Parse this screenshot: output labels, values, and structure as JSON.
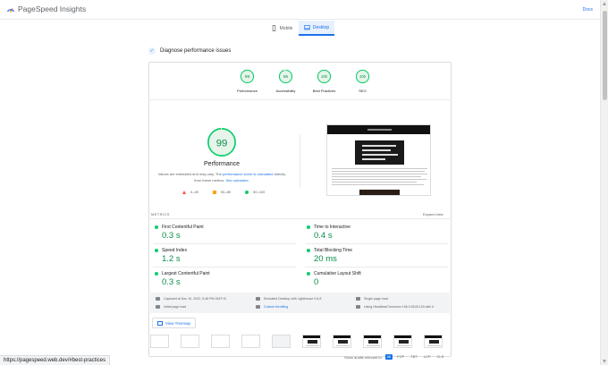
{
  "header": {
    "title": "PageSpeed Insights",
    "docs_label": "Docs"
  },
  "tabs": [
    {
      "label": "Mobile",
      "icon": "mobile-icon"
    },
    {
      "label": "Desktop",
      "icon": "desktop-icon"
    }
  ],
  "diagnose": {
    "label": "Diagnose performance issues"
  },
  "categories": [
    {
      "label": "Performance",
      "score": 99
    },
    {
      "label": "Accessibility",
      "score": 96
    },
    {
      "label": "Best Practices",
      "score": 100
    },
    {
      "label": "SEO",
      "score": 100
    }
  ],
  "performance": {
    "score": 99,
    "title": "Performance",
    "note_before": "Values are estimated and may vary. The ",
    "note_link1": "performance score is calculated",
    "note_middle": " directly from these metrics. ",
    "note_link2": "See calculator."
  },
  "legend": [
    {
      "label": "0–49"
    },
    {
      "label": "50–89"
    },
    {
      "label": "90–100"
    }
  ],
  "metrics": {
    "section_label": "METRICS",
    "expand_label": "Expand view",
    "items": [
      {
        "name": "First Contentful Paint",
        "value": "0.3 s"
      },
      {
        "name": "Time to Interactive",
        "value": "0.4 s"
      },
      {
        "name": "Speed Index",
        "value": "1.2 s"
      },
      {
        "name": "Total Blocking Time",
        "value": "20 ms"
      },
      {
        "name": "Largest Contentful Paint",
        "value": "0.3 s"
      },
      {
        "name": "Cumulative Layout Shift",
        "value": "0"
      }
    ]
  },
  "run_info": {
    "captured": "Captured at Dec 10, 2022, 5:48 PM GMT+8",
    "emulated": "Emulated Desktop with Lighthouse 9.6.8",
    "single_load": "Single page load",
    "initial_load": "Initial page load",
    "throttling": "Custom throttling",
    "browser": "Using HeadlessChromium 106.0.5249.103 with lr"
  },
  "treemap_label": "View Treemap",
  "audit_filter": {
    "label": "Show audits relevant to:",
    "chips": [
      "All",
      "FCP",
      "TBT",
      "LCP",
      "CLS"
    ]
  },
  "status_url": "https://pagespeed.web.dev/#best-practices",
  "colors": {
    "pass": "#0cce6b",
    "pass_text": "#0c8e4a",
    "average": "#ffa400",
    "fail": "#ff4e42",
    "accent": "#1a73e8"
  }
}
